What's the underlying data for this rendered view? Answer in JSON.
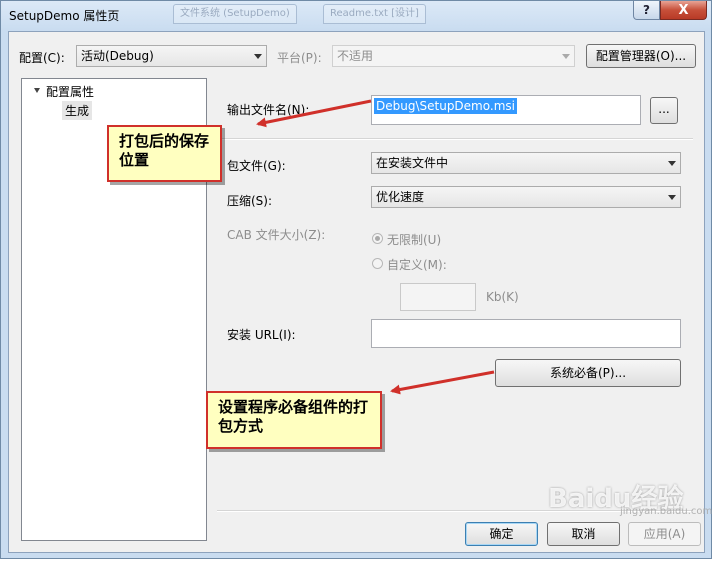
{
  "window": {
    "title": "SetupDemo 属性页",
    "help_glyph": "?",
    "close_glyph": "X",
    "background_tabs": [
      "文件系统 (SetupDemo)",
      "Readme.txt [设计]"
    ]
  },
  "config": {
    "config_label": "配置(C):",
    "config_value": "活动(Debug)",
    "platform_label": "平台(P):",
    "platform_value": "不适用",
    "manager_button": "配置管理器(O)..."
  },
  "tree": {
    "root_label": "配置属性",
    "child_label": "生成"
  },
  "form": {
    "output_label": "输出文件名(N):",
    "output_value": "Debug\\SetupDemo.msi",
    "browse_button": "...",
    "package_label": "包文件(G):",
    "package_value": "在安装文件中",
    "compress_label": "压缩(S):",
    "compress_value": "优化速度",
    "cab_label": "CAB 文件大小(Z):",
    "unlimited_label": "无限制(U)",
    "custom_label": "自定义(M):",
    "kb_label": "Kb(K)",
    "url_label": "安装 URL(I):",
    "url_value": "",
    "prereq_button": "系统必备(P)..."
  },
  "footer": {
    "ok_button": "确定",
    "cancel_button": "取消",
    "apply_button": "应用(A)"
  },
  "annotations": {
    "callout1": "打包后的保存位置",
    "callout2": "设置程序必备组件的打包方式",
    "arrow_color": "#d0302a"
  },
  "watermark": {
    "text": "Baidu经验",
    "sub": "jingyan.baidu.com"
  }
}
